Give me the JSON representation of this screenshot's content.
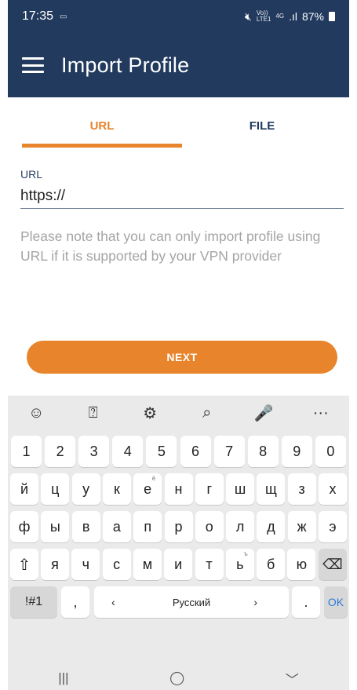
{
  "status_bar": {
    "time": "17:35",
    "left_icon": "notification-icon",
    "network_top": "Vo))",
    "network_bottom": "LTE1",
    "signal_type": "4G",
    "battery": "87%"
  },
  "app_bar": {
    "title": "Import Profile",
    "menu_icon": "hamburger-menu-icon"
  },
  "tabs": [
    {
      "label": "URL",
      "active": true
    },
    {
      "label": "FILE",
      "active": false
    }
  ],
  "url_field": {
    "label": "URL",
    "value": "https://"
  },
  "note": "Please note that you can only import profile using URL if it is supported by your VPN provider",
  "next_button": "NEXT",
  "colors": {
    "primary": "#223a5e",
    "accent": "#e8842b",
    "note_text": "#a4a4a4"
  },
  "keyboard": {
    "toolbar": [
      "☺",
      "⍰",
      "⚙",
      "⌕",
      "🎤",
      "···"
    ],
    "toolbar_icons": [
      "emoji-icon",
      "sticker-icon",
      "settings-icon",
      "search-icon",
      "microphone-icon",
      "more-icon"
    ],
    "row_digits": [
      "1",
      "2",
      "3",
      "4",
      "5",
      "6",
      "7",
      "8",
      "9",
      "0"
    ],
    "row1": [
      "й",
      "ц",
      "у",
      "к",
      "е",
      "н",
      "г",
      "ш",
      "щ",
      "з",
      "х"
    ],
    "row1_sup_e": "ё",
    "row2": [
      "ф",
      "ы",
      "в",
      "а",
      "п",
      "р",
      "о",
      "л",
      "д",
      "ж",
      "э"
    ],
    "row3": [
      "я",
      "ч",
      "с",
      "м",
      "и",
      "т",
      "ь",
      "б",
      "ю"
    ],
    "row3_sup_soft": "ъ",
    "shift": "⇧",
    "backspace": "⌫",
    "symbols": "!#1",
    "comma": ",",
    "lang_left": "‹",
    "language": "Русский",
    "lang_right": "›",
    "period": ".",
    "ok": "OK"
  },
  "nav_bar": {
    "recents": "|||",
    "home": "◯",
    "back": "﹀"
  }
}
